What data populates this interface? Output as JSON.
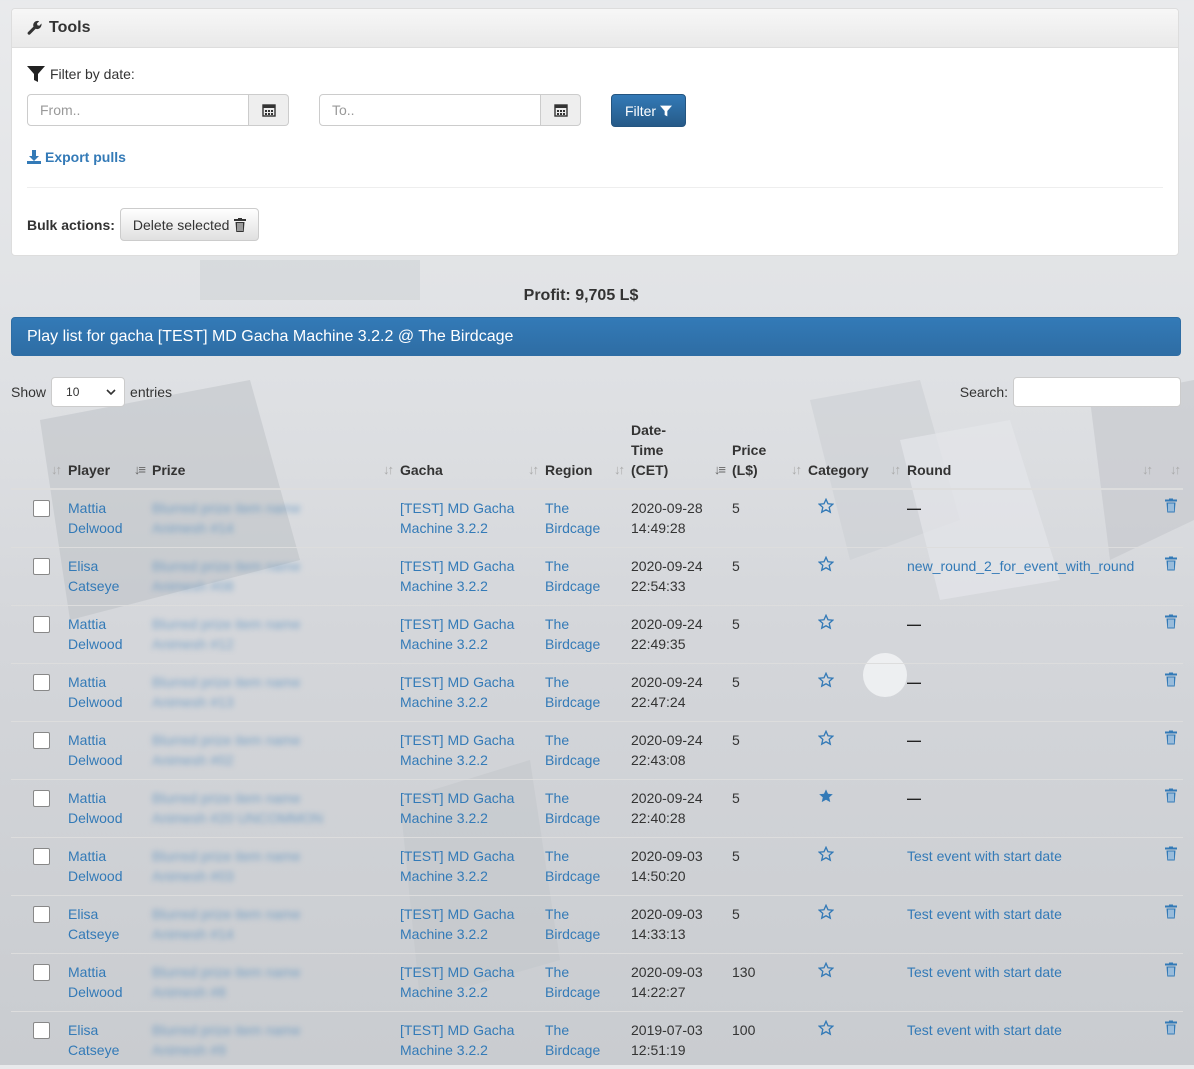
{
  "tools": {
    "title": "Tools",
    "filter_label": "Filter by date:",
    "from_placeholder": "From..",
    "to_placeholder": "To..",
    "filter_button": "Filter",
    "export_label": "Export pulls",
    "bulk_label": "Bulk actions:",
    "delete_selected": "Delete selected"
  },
  "profit": "Profit: 9,705 L$",
  "playlist_title": "Play list for gacha [TEST] MD Gacha Machine 3.2.2 @ The Birdcage",
  "show": {
    "label_before": "Show",
    "value": "10",
    "label_after": "entries"
  },
  "search": {
    "label": "Search:"
  },
  "columns": {
    "player": "Player",
    "prize": "Prize",
    "gacha": "Gacha",
    "region": "Region",
    "datetime": [
      "Date-",
      "Time",
      "(CET)"
    ],
    "price": [
      "Price",
      "(L$)"
    ],
    "category": "Category",
    "round": "Round"
  },
  "rows": [
    {
      "player": [
        "Mattia",
        "Delwood"
      ],
      "prize": [
        "Blurred prize item name",
        "Animesh #14"
      ],
      "gacha": [
        "[TEST] MD Gacha",
        "Machine 3.2.2"
      ],
      "region": [
        "The",
        "Birdcage"
      ],
      "date": "2020-09-28",
      "time": "14:49:28",
      "price": "5",
      "favorite": false,
      "round": "—"
    },
    {
      "player": [
        "Elisa",
        "Catseye"
      ],
      "prize": [
        "Blurred prize item name",
        "Animesh #08"
      ],
      "gacha": [
        "[TEST] MD Gacha",
        "Machine 3.2.2"
      ],
      "region": [
        "The",
        "Birdcage"
      ],
      "date": "2020-09-24",
      "time": "22:54:33",
      "price": "5",
      "favorite": false,
      "round": "new_round_2_for_event_with_round"
    },
    {
      "player": [
        "Mattia",
        "Delwood"
      ],
      "prize": [
        "Blurred prize item name",
        "Animesh #12"
      ],
      "gacha": [
        "[TEST] MD Gacha",
        "Machine 3.2.2"
      ],
      "region": [
        "The",
        "Birdcage"
      ],
      "date": "2020-09-24",
      "time": "22:49:35",
      "price": "5",
      "favorite": false,
      "round": "—"
    },
    {
      "player": [
        "Mattia",
        "Delwood"
      ],
      "prize": [
        "Blurred prize item name",
        "Animesh #13"
      ],
      "gacha": [
        "[TEST] MD Gacha",
        "Machine 3.2.2"
      ],
      "region": [
        "The",
        "Birdcage"
      ],
      "date": "2020-09-24",
      "time": "22:47:24",
      "price": "5",
      "favorite": false,
      "round": "—"
    },
    {
      "player": [
        "Mattia",
        "Delwood"
      ],
      "prize": [
        "Blurred prize item name",
        "Animesh #02"
      ],
      "gacha": [
        "[TEST] MD Gacha",
        "Machine 3.2.2"
      ],
      "region": [
        "The",
        "Birdcage"
      ],
      "date": "2020-09-24",
      "time": "22:43:08",
      "price": "5",
      "favorite": false,
      "round": "—"
    },
    {
      "player": [
        "Mattia",
        "Delwood"
      ],
      "prize": [
        "Blurred prize item name",
        "Animesh #20 UNCOMMON"
      ],
      "gacha": [
        "[TEST] MD Gacha",
        "Machine 3.2.2"
      ],
      "region": [
        "The",
        "Birdcage"
      ],
      "date": "2020-09-24",
      "time": "22:40:28",
      "price": "5",
      "favorite": true,
      "round": "—"
    },
    {
      "player": [
        "Mattia",
        "Delwood"
      ],
      "prize": [
        "Blurred prize item name",
        "Animesh #03"
      ],
      "gacha": [
        "[TEST] MD Gacha",
        "Machine 3.2.2"
      ],
      "region": [
        "The",
        "Birdcage"
      ],
      "date": "2020-09-03",
      "time": "14:50:20",
      "price": "5",
      "favorite": false,
      "round": "Test event with start date"
    },
    {
      "player": [
        "Elisa",
        "Catseye"
      ],
      "prize": [
        "Blurred prize item name",
        "Animesh #14"
      ],
      "gacha": [
        "[TEST] MD Gacha",
        "Machine 3.2.2"
      ],
      "region": [
        "The",
        "Birdcage"
      ],
      "date": "2020-09-03",
      "time": "14:33:13",
      "price": "5",
      "favorite": false,
      "round": "Test event with start date"
    },
    {
      "player": [
        "Mattia",
        "Delwood"
      ],
      "prize": [
        "Blurred prize item name",
        "Animesh #8"
      ],
      "gacha": [
        "[TEST] MD Gacha",
        "Machine 3.2.2"
      ],
      "region": [
        "The",
        "Birdcage"
      ],
      "date": "2020-09-03",
      "time": "14:22:27",
      "price": "130",
      "favorite": false,
      "round": "Test event with start date"
    },
    {
      "player": [
        "Elisa",
        "Catseye"
      ],
      "prize": [
        "Blurred prize item name",
        "Animesh #9"
      ],
      "gacha": [
        "[TEST] MD Gacha",
        "Machine 3.2.2"
      ],
      "region": [
        "The",
        "Birdcage"
      ],
      "date": "2019-07-03",
      "time": "12:51:19",
      "price": "100",
      "favorite": false,
      "round": "Test event with start date"
    }
  ],
  "colors": {
    "primary": "#337ab7",
    "border": "#dddddd"
  }
}
